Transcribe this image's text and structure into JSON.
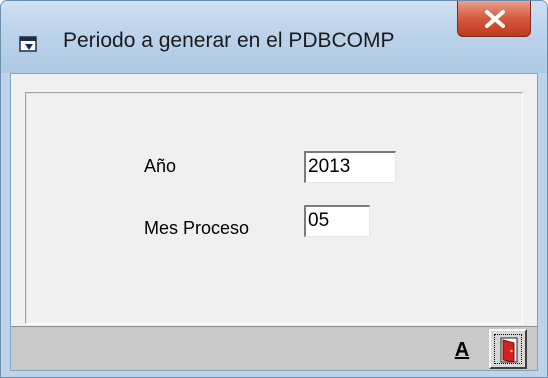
{
  "window": {
    "title": "Periodo a generar en el PDBCOMP",
    "icon": "window-app-icon",
    "close_icon": "close-x-icon",
    "close_color": "#c8442a"
  },
  "form": {
    "year_label": "Año",
    "year_value": "2013",
    "month_label": "Mes Proceso",
    "month_value": "05"
  },
  "toolbar": {
    "accept_label": "A",
    "exit_icon": "exit-door-icon",
    "exit_color": "#d42020"
  }
}
